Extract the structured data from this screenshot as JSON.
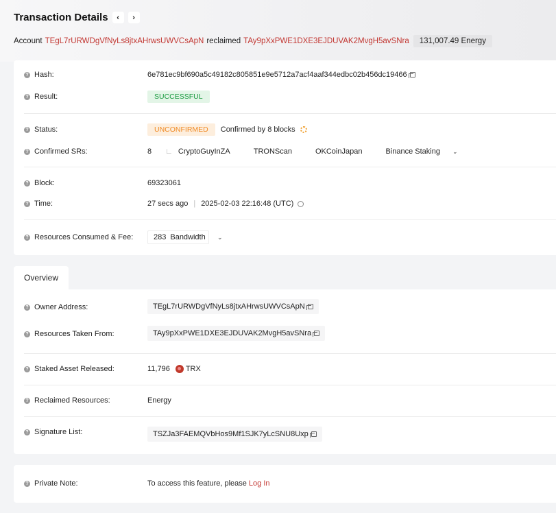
{
  "header": {
    "title": "Transaction Details",
    "prev_icon": "‹",
    "next_icon": "›"
  },
  "account_line": {
    "prefix": "Account",
    "owner": "TEgL7rURWDgVfNyLs8jtxAHrwsUWVCsApN",
    "verb": "reclaimed",
    "receiver": "TAy9pXxPWE1DXE3EJDUVAK2MvgH5avSNra",
    "amount": "131,007.49 Energy"
  },
  "summary": {
    "hash_label": "Hash:",
    "hash_value": "6e781ec9bf690a5c49182c805851e9e5712a7acf4aaf344edbc02b456dc19466",
    "result_label": "Result:",
    "result_value": "SUCCESSFUL",
    "status_label": "Status:",
    "status_value": "UNCONFIRMED",
    "confirmed_text": "Confirmed by 8 blocks",
    "srs_label": "Confirmed SRs:",
    "srs_count": "8",
    "srs": [
      "CryptoGuyInZA",
      "TRONScan",
      "OKCoinJapan",
      "Binance Staking"
    ],
    "block_label": "Block:",
    "block_value": "69323061",
    "time_label": "Time:",
    "time_ago": "27 secs ago",
    "time_sep": "|",
    "time_value": "2025-02-03 22:16:48 (UTC)",
    "resources_label": "Resources Consumed & Fee:",
    "bandwidth_value": "283",
    "bandwidth_unit": "Bandwidth"
  },
  "tabs": {
    "overview": "Overview"
  },
  "overview": {
    "owner_label": "Owner Address:",
    "owner_value": "TEgL7rURWDgVfNyLs8jtxAHrwsUWVCsApN",
    "from_label": "Resources Taken From:",
    "from_value": "TAy9pXxPWE1DXE3EJDUVAK2MvgH5avSNra",
    "staked_label": "Staked Asset Released:",
    "staked_value": "11,796",
    "staked_unit": "TRX",
    "reclaimed_label": "Reclaimed Resources:",
    "reclaimed_value": "Energy",
    "signature_label": "Signature List:",
    "signature_value": "TSZJa3FAEMQVbHos9Mf1SJK7yLcSNU8Uxp"
  },
  "note": {
    "label": "Private Note:",
    "text": "To access this feature, please",
    "link": "Log In"
  }
}
